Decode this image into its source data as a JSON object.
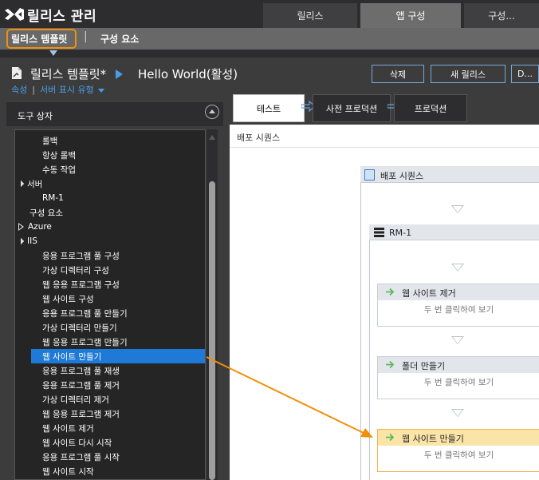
{
  "app": {
    "title": "릴리스 관리"
  },
  "top_tabs": [
    {
      "label": "릴리스",
      "active": false
    },
    {
      "label": "앱 구성",
      "active": true
    },
    {
      "label": "구성...",
      "active": false
    }
  ],
  "subnav": {
    "items": [
      "릴리스 템플릿",
      "구성 요소"
    ],
    "separator": "|"
  },
  "header": {
    "template_name": "릴리스 템플릿*",
    "release_path": "Hello World(활성)",
    "links": [
      "속성",
      "서버 표시 유형"
    ],
    "link_separator": "|",
    "buttons": [
      "삭제",
      "새 릴리스",
      "D..."
    ]
  },
  "toolbox": {
    "title": "도구 상자",
    "items": [
      {
        "label": "롤백",
        "indent": 2,
        "expander": ""
      },
      {
        "label": "항상 롤백",
        "indent": 2,
        "expander": ""
      },
      {
        "label": "수동 작업",
        "indent": 2,
        "expander": ""
      },
      {
        "label": "서버",
        "indent": 0,
        "expander": "open"
      },
      {
        "label": "RM-1",
        "indent": 2,
        "expander": ""
      },
      {
        "label": "구성 요소",
        "indent": 1,
        "expander": ""
      },
      {
        "label": "Azure",
        "indent": 0,
        "expander": "closed"
      },
      {
        "label": "IIS",
        "indent": 0,
        "expander": "open"
      },
      {
        "label": "응용 프로그램 풀 구성",
        "indent": 2,
        "expander": ""
      },
      {
        "label": "가상 디렉터리 구성",
        "indent": 2,
        "expander": ""
      },
      {
        "label": "웹 응용 프로그램 구성",
        "indent": 2,
        "expander": ""
      },
      {
        "label": "웹 사이트 구성",
        "indent": 2,
        "expander": ""
      },
      {
        "label": "응용 프로그램 풀 만들기",
        "indent": 2,
        "expander": ""
      },
      {
        "label": "가상 디렉터리 만들기",
        "indent": 2,
        "expander": ""
      },
      {
        "label": "웹 응용 프로그램 만들기",
        "indent": 2,
        "expander": ""
      },
      {
        "label": "웹 사이트 만들기",
        "indent": 2,
        "expander": "",
        "selected": true
      },
      {
        "label": "응용 프로그램 풀 재생",
        "indent": 2,
        "expander": ""
      },
      {
        "label": "응용 프로그램 풀 제거",
        "indent": 2,
        "expander": ""
      },
      {
        "label": "가상 디렉터리 제거",
        "indent": 2,
        "expander": ""
      },
      {
        "label": "웹 응용 프로그램 제거",
        "indent": 2,
        "expander": ""
      },
      {
        "label": "웹 사이트 제거",
        "indent": 2,
        "expander": ""
      },
      {
        "label": "웹 사이트 다시 시작",
        "indent": 2,
        "expander": ""
      },
      {
        "label": "응용 프로그램 풀 시작",
        "indent": 2,
        "expander": ""
      },
      {
        "label": "웹 사이트 시작",
        "indent": 2,
        "expander": ""
      }
    ]
  },
  "stages": [
    {
      "label": "테스트",
      "active": true
    },
    {
      "label": "사전 프로덕션",
      "active": false
    },
    {
      "label": "프로덕션",
      "active": false
    }
  ],
  "canvas": {
    "title": "배포 시퀀스",
    "sequence_label": "배포 시퀀스",
    "server_label": "RM-1",
    "activities": [
      {
        "title": "웹 사이트 제거",
        "body": "두 번 클릭하여 보기",
        "highlighted": false
      },
      {
        "title": "폴더 만들기",
        "body": "두 번 클릭하여 보기",
        "highlighted": false
      },
      {
        "title": "웹 사이트 만들기",
        "body": "두 번 클릭하여 보기",
        "highlighted": true
      }
    ]
  },
  "colors": {
    "accent_orange": "#f0900a",
    "link_blue": "#4a9ee8",
    "selection_blue": "#1e7ad6",
    "activity_arrow_green": "#5cb85c"
  },
  "icons": [
    "vs-logo-icon",
    "document-icon",
    "play-arrow-icon",
    "chevron-down-icon",
    "collapse-up-icon",
    "stage-arrow-icon",
    "sequence-icon",
    "server-icon",
    "activity-arrow-icon"
  ]
}
